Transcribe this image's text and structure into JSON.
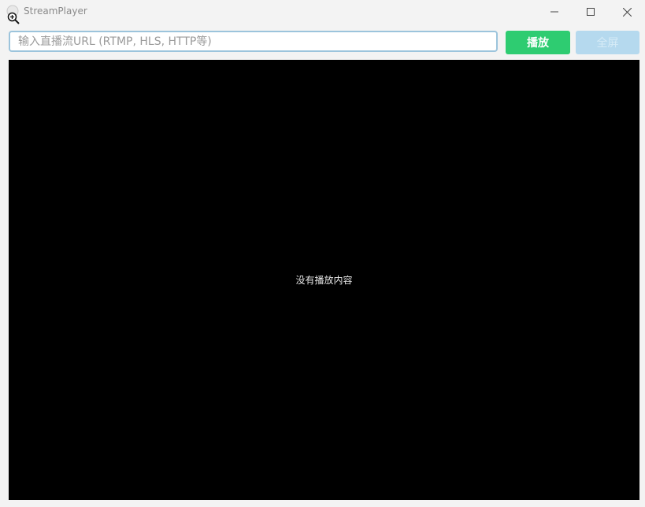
{
  "window": {
    "title": "StreamPlayer"
  },
  "toolbar": {
    "url_input": {
      "value": "",
      "placeholder": "输入直播流URL (RTMP, HLS, HTTP等)"
    },
    "play_label": "播放",
    "fullscreen_label": "全屏"
  },
  "player": {
    "empty_message": "没有播放内容"
  },
  "colors": {
    "play_button": "#2ecc71",
    "fullscreen_button_disabled": "#b5d9ee",
    "input_border": "#9cc4dc",
    "video_background": "#000000"
  },
  "icons": {
    "app": "app-logo-icon",
    "overlay": "zoom-in-icon",
    "minimize": "minimize-icon",
    "maximize": "maximize-icon",
    "close": "close-icon"
  }
}
